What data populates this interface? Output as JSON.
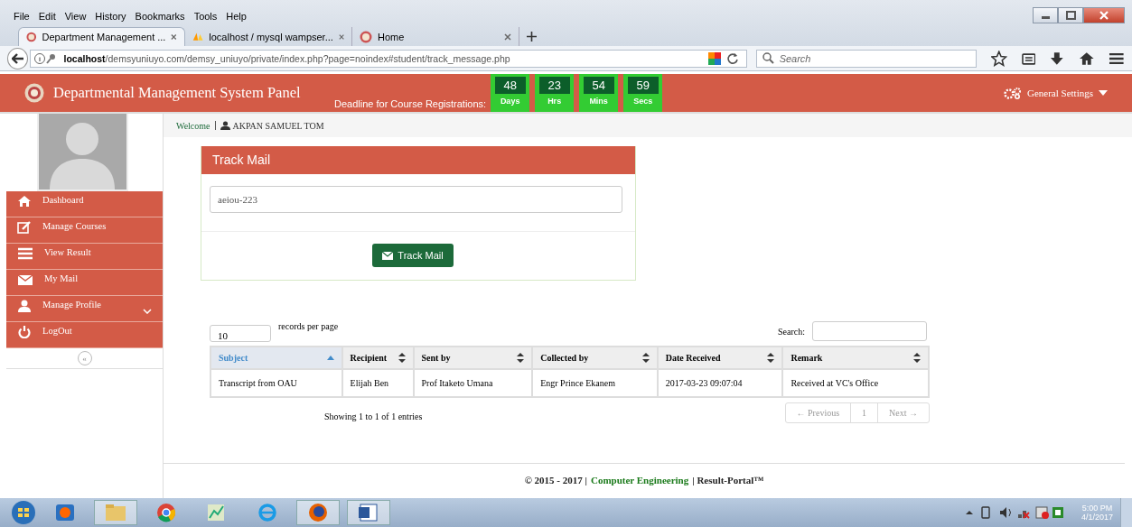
{
  "browser": {
    "menu": [
      "File",
      "Edit",
      "View",
      "History",
      "Bookmarks",
      "Tools",
      "Help"
    ],
    "tabs": [
      {
        "label": "Department Management ...",
        "selected": true,
        "kind": "app"
      },
      {
        "label": "localhost / mysql wampser...",
        "selected": false,
        "kind": "pma"
      },
      {
        "label": "Home",
        "selected": false,
        "kind": "app"
      }
    ],
    "url_host": "localhost",
    "url_path": "/demsyuniuyo.com/demsy_uniuyo/private/index.php?page=noindex#student/track_message.php",
    "search": {
      "placeholder": "Search"
    }
  },
  "header": {
    "title": "Departmental Management System Panel",
    "deadline_label": "Deadline for Course Registrations:",
    "countdown": [
      {
        "value": "48",
        "unit": "Days"
      },
      {
        "value": "23",
        "unit": "Hrs"
      },
      {
        "value": "54",
        "unit": "Mins"
      },
      {
        "value": "59",
        "unit": "Secs"
      }
    ],
    "settings": "General Settings"
  },
  "sidebar": {
    "items": [
      {
        "label": "Dashboard",
        "kind": "home",
        "expandable": false
      },
      {
        "label": "Manage Courses",
        "kind": "edit",
        "expandable": false
      },
      {
        "label": "View Result",
        "kind": "list",
        "expandable": false
      },
      {
        "label": "My Mail",
        "kind": "mail",
        "expandable": false
      },
      {
        "label": "Manage Profile",
        "kind": "user",
        "expandable": true
      },
      {
        "label": "LogOut",
        "kind": "power",
        "expandable": false
      }
    ],
    "collapse": "«"
  },
  "welcome": {
    "label": "Welcome",
    "user": "AKPAN SAMUEL TOM"
  },
  "track_panel": {
    "title": "Track Mail",
    "value": "aeiou-223",
    "button": "Track Mail"
  },
  "table": {
    "page_size": "10",
    "page_size_label": "records per page",
    "search_label": "Search:",
    "columns": [
      {
        "label": "Subject",
        "selected": true
      },
      {
        "label": "Recipient",
        "selected": false
      },
      {
        "label": "Sent by",
        "selected": false
      },
      {
        "label": "Collected by",
        "selected": false
      },
      {
        "label": "Date Received",
        "selected": false
      },
      {
        "label": "Remark",
        "selected": false
      }
    ],
    "rows": [
      [
        "Transcript from OAU",
        "Elijah Ben",
        "Prof Itaketo Umana",
        "Engr Prince Ekanem",
        "2017-03-23 09:07:04",
        "Received at VC's Office"
      ]
    ],
    "info": "Showing 1 to 1 of 1 entries",
    "pagination": [
      "← Previous",
      "1",
      "Next →"
    ]
  },
  "footer": {
    "prefix": "© 2015 - 2017 |",
    "link": "Computer Engineering",
    "suffix": "| Result-Portal™"
  },
  "taskbar": {
    "time": "5:00 PM",
    "date": "4/1/2017"
  }
}
